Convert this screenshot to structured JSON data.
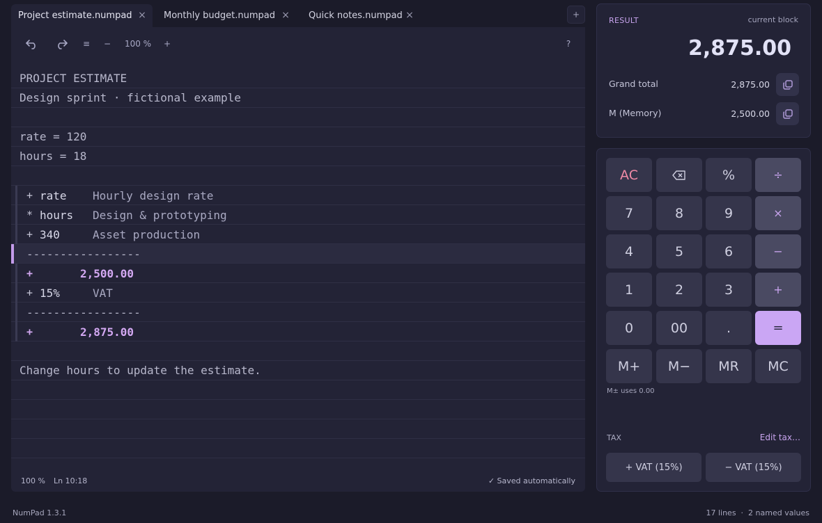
{
  "tabs": [
    {
      "label": "Project estimate.numpad",
      "active": true
    },
    {
      "label": "Monthly budget.numpad",
      "active": false
    },
    {
      "label": "Quick notes.numpad",
      "active": false
    }
  ],
  "tab_add_label": "+",
  "toolbar": {
    "menu": "≡",
    "zoom_out": "−",
    "zoom": "100 %",
    "zoom_in": "+",
    "help": "?"
  },
  "lines": {
    "title": "PROJECT ESTIMATE",
    "subtitle": "Design sprint · fictional example",
    "rate_def": "rate = 120",
    "hours_def": "hours = 18",
    "b1": {
      "op": "+",
      "operand": "rate",
      "comment": "Hourly design rate"
    },
    "b2": {
      "op": "*",
      "operand": "hours",
      "comment": "Design & prototyping"
    },
    "b3": {
      "op": "+",
      "operand": "340",
      "comment": "Asset production"
    },
    "sep": "-----------------",
    "sub": {
      "op": "+",
      "value": "2,500.00"
    },
    "vat": {
      "op": "+",
      "operand": "15%",
      "comment": "VAT"
    },
    "grand": {
      "op": "+",
      "value": "2,875.00"
    },
    "note": "Change hours to update the estimate."
  },
  "status": {
    "zoom": "100 %",
    "cursor": "Ln 10:18",
    "saved": "✓ Saved automatically"
  },
  "result": {
    "label": "RESULT",
    "scope": "current block",
    "value": "2,875.00",
    "grand_total_label": "Grand total",
    "grand_total_value": "2,875.00",
    "memory_label": "M (Memory)",
    "memory_value": "2,500.00"
  },
  "keypad": {
    "ac": "AC",
    "percent": "%",
    "divide": "÷",
    "k7": "7",
    "k8": "8",
    "k9": "9",
    "multiply": "×",
    "k4": "4",
    "k5": "5",
    "k6": "6",
    "minus": "−",
    "k1": "1",
    "k2": "2",
    "k3": "3",
    "plus": "+",
    "k0": "0",
    "k00": "00",
    "dot": ".",
    "equals": "=",
    "mplus": "M+",
    "mminus": "M−",
    "mr": "MR",
    "mc": "MC",
    "mem_note": "M± uses 0.00",
    "tax_label": "TAX",
    "tax_edit": "Edit tax…",
    "vat_add": "+ VAT (15%)",
    "vat_sub": "− VAT (15%)"
  },
  "footer": {
    "version": "NumPad 1.3.1",
    "summary": "17 lines  ·  2 named values"
  },
  "colors": {
    "accent": "#caa6f4",
    "background": "#1b1b29",
    "panel": "#232336"
  }
}
